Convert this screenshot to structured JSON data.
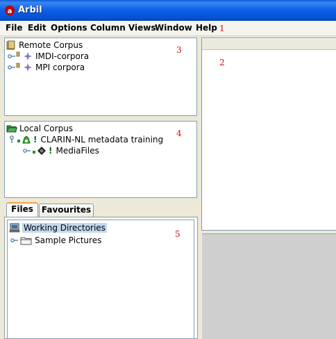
{
  "window": {
    "title": "Arbil"
  },
  "menu": {
    "items": [
      "File",
      "Edit",
      "Options",
      "Column Views",
      "Window",
      "Help"
    ],
    "marker": "1"
  },
  "remote_corpus": {
    "marker": "3",
    "root_label": "Remote Corpus",
    "children": [
      "IMDI-corpora",
      "MPI corpora"
    ]
  },
  "local_corpus": {
    "marker": "4",
    "root_label": "Local Corpus",
    "child_label": "CLARIN-NL metadata training",
    "grandchild_label": "MediaFiles"
  },
  "files_panel": {
    "marker": "5",
    "tabs": [
      "Files",
      "Favourites"
    ],
    "root_label": "Working Directories",
    "children": [
      "Sample Pictures"
    ]
  },
  "right_panel": {
    "marker": "2"
  },
  "colors": {
    "titlebar": "#0a5ee8",
    "marker": "#d01010",
    "selection": "#c3d8ee"
  }
}
